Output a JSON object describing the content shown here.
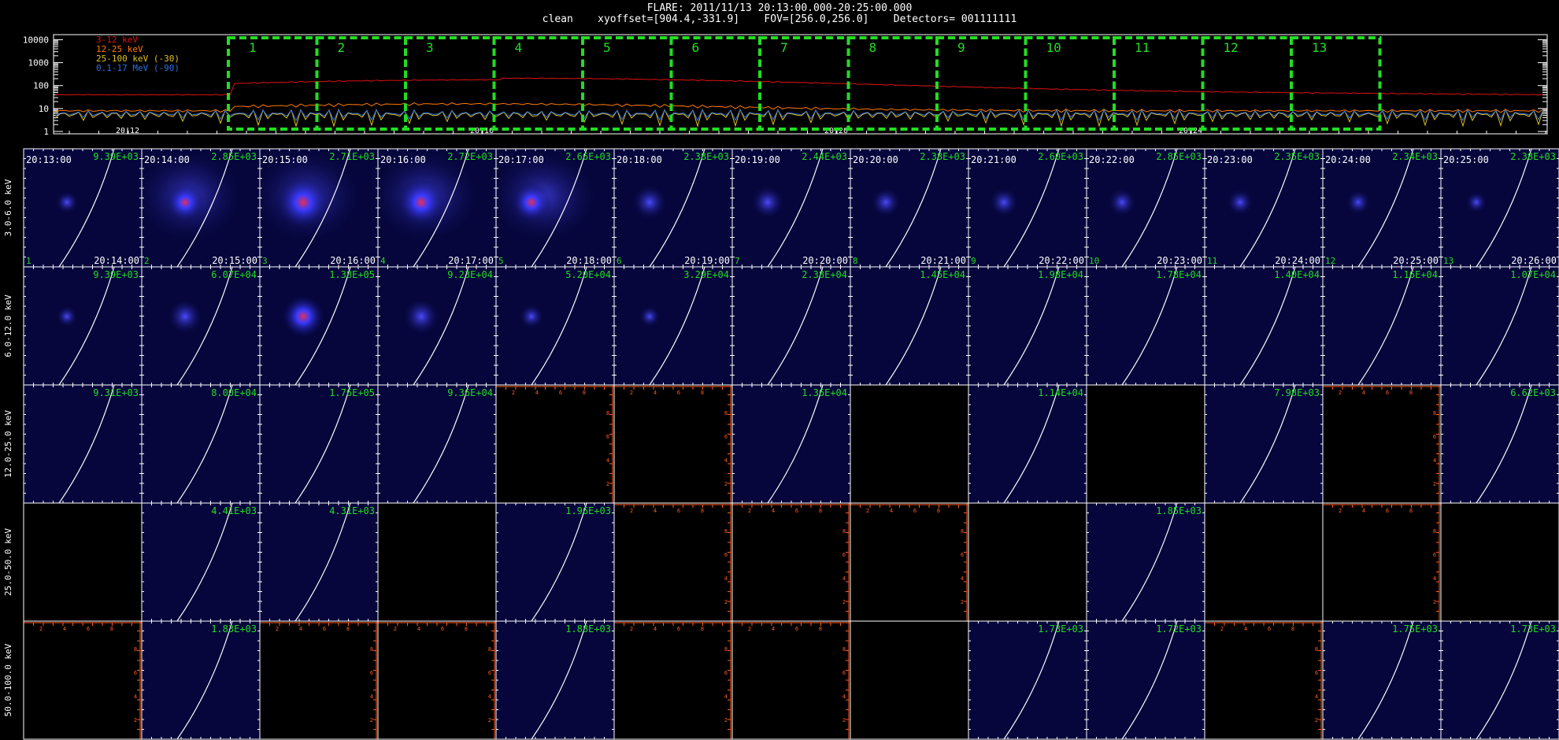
{
  "header": {
    "line1": "FLARE: 2011/11/13 20:13:00.000-20:25:00.000",
    "line2": "clean    xyoffset=[904.4,-331.9]    FOV=[256.0,256.0]    Detectors= 001111111"
  },
  "lightcurve": {
    "yticks": [
      "10000",
      "1000",
      "100",
      "10",
      "1"
    ],
    "xticks": [
      "20:12",
      "20:16",
      "20:20",
      "20:24"
    ],
    "legend": [
      {
        "label": "3-12 keV",
        "color": "#e01010"
      },
      {
        "label": "12-25 keV",
        "color": "#ff7a00"
      },
      {
        "label": "25-100 keV (-30)",
        "color": "#e0c020"
      },
      {
        "label": "0.1-17 MeV (-90)",
        "color": "#3070e0"
      }
    ],
    "intervals": [
      "1",
      "2",
      "3",
      "4",
      "5",
      "6",
      "7",
      "8",
      "9",
      "10",
      "11",
      "12",
      "13"
    ],
    "interval_color": "#22dd22"
  },
  "grid": {
    "row_labels": [
      "3.0-6.0 keV",
      "6.0-12.0 keV",
      "12.0-25.0 keV",
      "25.0-50.0 keV",
      "50.0-100.0 keV"
    ],
    "start_times": [
      "20:13:00",
      "20:14:00",
      "20:15:00",
      "20:16:00",
      "20:17:00",
      "20:18:00",
      "20:19:00",
      "20:20:00",
      "20:21:00",
      "20:22:00",
      "20:23:00",
      "20:24:00",
      "20:25:00"
    ],
    "end_times": [
      "20:14:00",
      "20:15:00",
      "20:16:00",
      "20:17:00",
      "20:18:00",
      "20:19:00",
      "20:20:00",
      "20:21:00",
      "20:22:00",
      "20:23:00",
      "20:24:00",
      "20:25:00",
      "20:26:00"
    ],
    "interval_numbers": [
      "1",
      "2",
      "3",
      "4",
      "5",
      "6",
      "7",
      "8",
      "9",
      "10",
      "11",
      "12",
      "13"
    ],
    "max_values": [
      [
        "9.39E+03",
        "2.85E+03",
        "2.71E+03",
        "2.72E+03",
        "2.66E+03",
        "2.38E+03",
        "2.44E+03",
        "2.38E+03",
        "2.60E+03",
        "2.85E+03",
        "2.35E+03",
        "2.34E+03",
        "2.38E+03"
      ],
      [
        "9.39E+03",
        "6.07E+04",
        "1.38E+05",
        "9.23E+04",
        "5.20E+04",
        "3.29E+04",
        "2.38E+04",
        "1.45E+04",
        "1.98E+04",
        "1.78E+04",
        "1.40E+04",
        "1.16E+04",
        "1.07E+04"
      ],
      [
        "9.31E+03",
        "8.00E+04",
        "1.76E+05",
        "9.36E+04",
        "",
        "",
        "1.36E+04",
        "",
        "1.14E+04",
        "",
        "7.98E+03",
        "",
        "6.62E+03"
      ],
      [
        "",
        "4.41E+03",
        "4.31E+03",
        "",
        "1.96E+03",
        "",
        "",
        "",
        "",
        "1.85E+03",
        "",
        "",
        ""
      ],
      [
        "",
        "1.83E+03",
        "",
        "",
        "1.88E+03",
        "",
        "",
        "",
        "1.73E+03",
        "1.72E+03",
        "",
        "1.75E+03",
        "1.73E+03"
      ]
    ],
    "panel_status": [
      [
        "img",
        "img",
        "img",
        "img",
        "img",
        "img",
        "img",
        "img",
        "img",
        "img",
        "img",
        "img",
        "img"
      ],
      [
        "img",
        "img",
        "img",
        "img",
        "img",
        "img",
        "img",
        "img",
        "img",
        "img",
        "img",
        "img",
        "img"
      ],
      [
        "img",
        "img",
        "img",
        "img",
        "empty_axes",
        "empty_axes",
        "img",
        "empty",
        "img",
        "empty",
        "img",
        "empty_axes",
        "img"
      ],
      [
        "empty",
        "img",
        "img",
        "empty",
        "img",
        "empty_axes",
        "empty_axes",
        "empty_axes",
        "empty",
        "img",
        "empty",
        "empty_axes",
        "empty"
      ],
      [
        "empty_axes",
        "img",
        "empty_axes",
        "empty_axes",
        "img",
        "empty_axes",
        "empty_axes",
        "empty",
        "img",
        "img",
        "empty_axes",
        "img",
        "img"
      ]
    ],
    "source_intensity": [
      [
        0.1,
        0.55,
        0.95,
        0.8,
        0.6,
        0.45,
        0.4,
        0.3,
        0.28,
        0.25,
        0.2,
        0.15,
        0.05
      ],
      [
        0.05,
        0.45,
        0.7,
        0.5,
        0.15,
        0.05,
        0.02,
        0.02,
        0.02,
        0.02,
        0.02,
        0.02,
        0.02
      ],
      [
        0.0,
        0.0,
        0.0,
        0.0,
        0.0,
        0.0,
        0.0,
        0.0,
        0.0,
        0.0,
        0.0,
        0.0,
        0.0
      ],
      [
        0.0,
        0.0,
        0.0,
        0.0,
        0.0,
        0.0,
        0.0,
        0.0,
        0.0,
        0.0,
        0.0,
        0.0,
        0.0
      ],
      [
        0.0,
        0.0,
        0.0,
        0.0,
        0.0,
        0.0,
        0.0,
        0.0,
        0.0,
        0.0,
        0.0,
        0.0,
        0.0
      ]
    ],
    "axis_tick_labels": [
      "2",
      "4",
      "6",
      "8"
    ],
    "label_color": "#22dd22",
    "axis_color": "#ff5a1e"
  }
}
